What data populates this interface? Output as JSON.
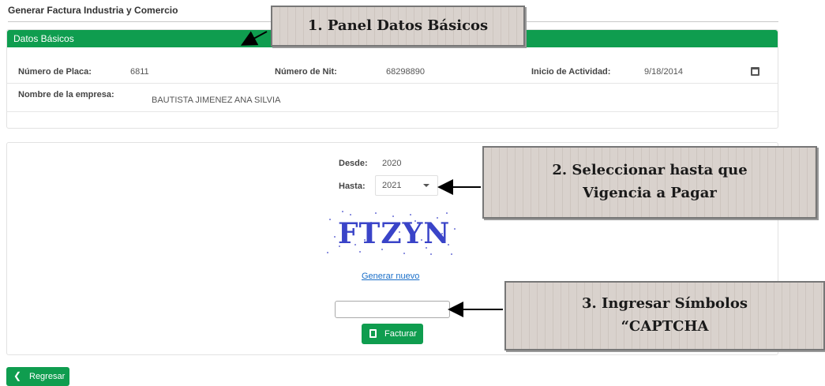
{
  "page": {
    "title": "Generar Factura Industria y Comercio"
  },
  "datos_basicos": {
    "header": "Datos Básicos",
    "numero_placa_label": "Número de Placa:",
    "numero_placa_value": "6811",
    "numero_nit_label": "Número de Nit:",
    "numero_nit_value": "68298890",
    "inicio_actividad_label": "Inicio de Actividad:",
    "inicio_actividad_value": "9/18/2014",
    "nombre_empresa_label": "Nombre de la empresa:",
    "nombre_empresa_value": "BAUTISTA JIMENEZ ANA SILVIA"
  },
  "vigencia": {
    "desde_label": "Desde:",
    "desde_value": "2020",
    "hasta_label": "Hasta:",
    "hasta_value": "2021"
  },
  "captcha": {
    "text": "FTZYN",
    "regenerate_label": "Generar nuevo",
    "input_value": ""
  },
  "buttons": {
    "facturar_label": "Facturar",
    "regresar_label": "Regresar"
  },
  "callouts": {
    "c1": "1. Panel Datos Básicos",
    "c2_line1": "2. Seleccionar hasta que",
    "c2_line2": "Vigencia a Pagar",
    "c3_line1": "3. Ingresar Símbolos",
    "c3_line2": "“CAPTCHA"
  },
  "colors": {
    "accent": "#0f9d4f",
    "link": "#1a6fc9"
  }
}
